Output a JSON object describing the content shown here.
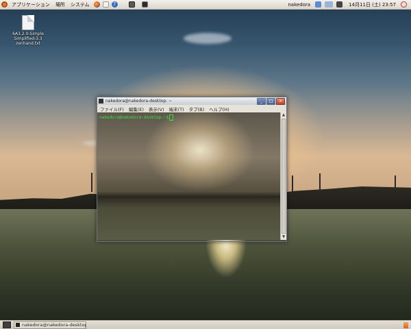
{
  "top_panel": {
    "menus": [
      "アプリケーション",
      "場所",
      "システム"
    ],
    "launchers": [
      "firefox-icon",
      "mail-icon",
      "help-icon",
      "monitor-icon",
      "terminal-icon"
    ],
    "user": "nakedora",
    "clock": "14月11日 (土) 23:57"
  },
  "desktop": {
    "icon_label": "6A3.2.0-Simple Simplified-3.3 zenhand.txt"
  },
  "terminal": {
    "title": "nakedora@nakedora-desktop: ~",
    "menus": [
      "ファイル(F)",
      "編集(E)",
      "表示(V)",
      "端末(T)",
      "タブ(B)",
      "ヘルプ(H)"
    ],
    "prompt": "nakedora@nakedora-desktop:~$"
  },
  "bottom_panel": {
    "task_label": "nakedora@nakedora-desktop: ~"
  },
  "colors": {
    "prompt_green": "#3fe13f",
    "panel_bg": "#e4ded4"
  }
}
